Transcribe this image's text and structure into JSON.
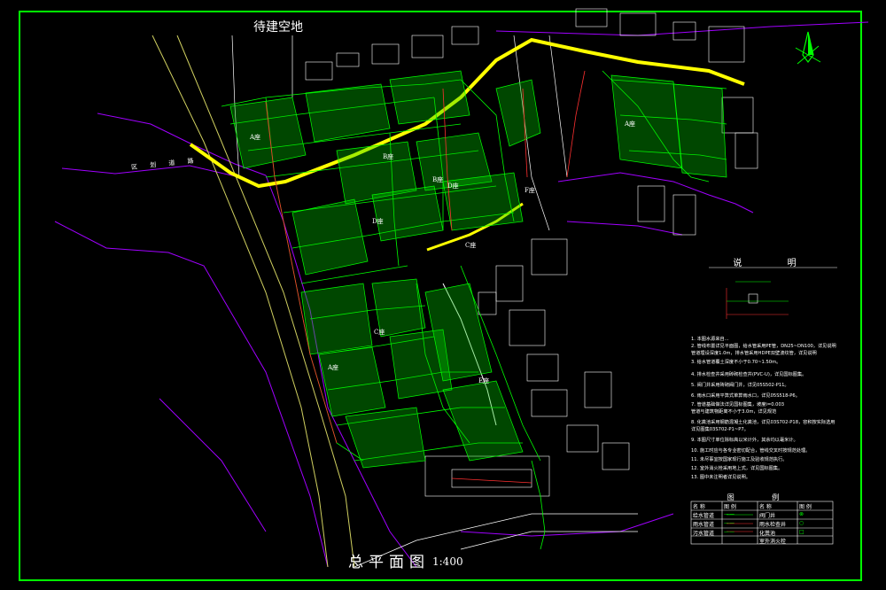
{
  "drawing": {
    "top_label": "待建空地",
    "plan_title": "总平面图",
    "scale": "1:400",
    "road_label": "区 划 道 路",
    "notes_heading": "说 明",
    "legend_heading": "图 例",
    "block_labels": [
      "A座",
      "A座",
      "A座",
      "B座",
      "B座",
      "C座",
      "C座",
      "D座",
      "D座",
      "E座",
      "F座"
    ]
  },
  "notes": [
    "1. 本图水源来自...",
    "2. 管线布置详见平面图，给水管采用PE管，DN25~DN100，详见说明",
    "   管道埋设深度1.0m，排水管采用HDPE双壁波纹管，详见说明",
    "3. 给水管道覆土深度不小于0.70~1.50m。",
    "4. 排水检查井采用砖砌检查井(PVC-U)，详见国标图集。",
    "5. 阀门井采用砖砌阀门井，详见05S502-P11。",
    "6. 雨水口采用平箅式单箅雨水口，详见05S518-P6。",
    "7. 管道基础做法详见国标图集，坡度i=0.003",
    "   管道与建筑物距离不小于3.0m，详见规范",
    "8. 化粪池采用钢筋混凝土化粪池，详见03S702-P18，容积按实际选用",
    "   详见图集03S702-P1~P7。",
    "9. 本图尺寸单位除标高以米计外，其余均以毫米计。",
    "10. 施工时应与各专业密切配合，管线交叉时按规范处理。",
    "11. 未尽事宜按国家现行施工及验收规范执行。",
    "12. 室外消火栓采用地上式，详见国标图集。",
    "13. 图中未注明者详见说明。"
  ],
  "legend_rows": [
    [
      "名 称",
      "图 例",
      "名 称",
      "图 例"
    ],
    [
      "给水管道",
      "——",
      "阀门井",
      "⊗"
    ],
    [
      "雨水管道",
      "——",
      "雨水检查井",
      "○"
    ],
    [
      "污水管道",
      "——",
      "化粪池",
      "□"
    ],
    [
      "",
      "",
      "室外消火栓",
      ""
    ]
  ],
  "colors": {
    "frame": "#00ff00",
    "pipe": "#00ff00",
    "road": "#ffff00",
    "boundary": "#a000ff",
    "building": "#ffffff",
    "sewer": "#ff3030"
  }
}
